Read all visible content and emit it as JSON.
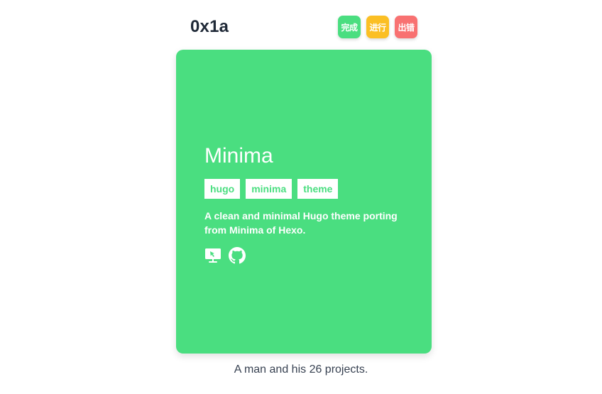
{
  "site": {
    "title": "0x1a"
  },
  "filters": [
    {
      "label": "完成",
      "color": "#4ade80"
    },
    {
      "label": "进行",
      "color": "#fbbf24"
    },
    {
      "label": "出错",
      "color": "#f87171"
    }
  ],
  "card": {
    "color": "#4ade80",
    "title": "Minima",
    "tags": [
      "hugo",
      "minima",
      "theme"
    ],
    "description": "A clean and minimal Hugo theme porting from Minima of Hexo.",
    "links": [
      {
        "icon": "demo-screen-icon"
      },
      {
        "icon": "github-icon"
      }
    ]
  },
  "footer": {
    "text": "A man and his 26 projects."
  }
}
